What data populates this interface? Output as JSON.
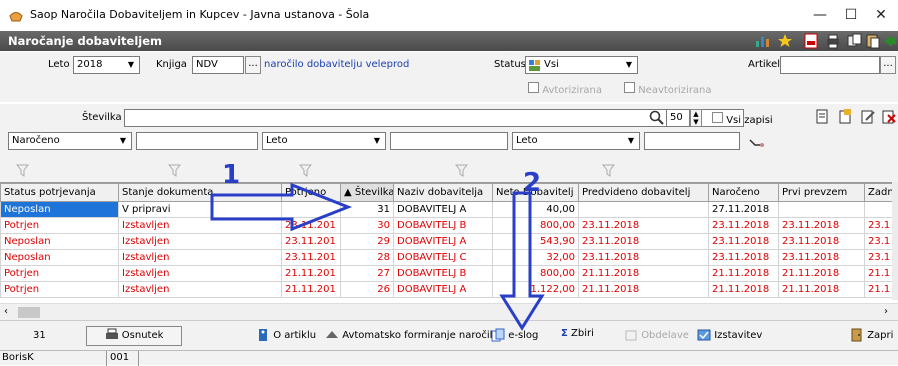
{
  "window": {
    "title": "Saop  Naročila Dobaviteljem in Kupcev - Javna ustanova - Šola",
    "minimize": "—",
    "maximize": "☐",
    "close": "✕"
  },
  "panel": {
    "title": "Naročanje dobaviteljem"
  },
  "filters": {
    "leto_label": "Leto",
    "leto_value": "2018",
    "knjiga_label": "Knjiga",
    "knjiga_value": "NDV",
    "knjiga_desc": "naročilo dobavitelju veleprod",
    "status_label": "Status",
    "status_value": "Vsi",
    "avtorizirana": "Avtorizirana",
    "neavtorizirana": "Neavtorizirana",
    "artikel_label": "Artikel",
    "ellipsis": "..."
  },
  "search": {
    "stevilka_label": "Številka",
    "count_value": "50",
    "vsi_zapisi": "Vsi zapisi",
    "narocen_value": "Naročeno",
    "leto1": "Leto",
    "leto2": "Leto"
  },
  "table": {
    "columns": [
      "Status potrjevanja",
      "Stanje dokumenta",
      "Potrjeno",
      "▲ Številka",
      "Naziv dobavitelja",
      "Neto Dobavitelj",
      "Predvideno dobavitelj",
      "Naročeno",
      "Prvi prevzem",
      "Zadn"
    ],
    "rows": [
      {
        "status": "Neposlan",
        "stanje": "V pripravi",
        "potrjeno": "",
        "st": "31",
        "naziv": "DOBAVITELJ  A",
        "neto": "40,00",
        "predv": "",
        "narocen": "27.11.2018",
        "prvi": "",
        "zadn": "",
        "red": false
      },
      {
        "status": "Potrjen",
        "stanje": "Izstavljen",
        "potrjeno": "23.11.201",
        "st": "30",
        "naziv": "DOBAVITELJ  B",
        "neto": "800,00",
        "predv": "23.11.2018",
        "narocen": "23.11.2018",
        "prvi": "23.11.2018",
        "zadn": "23.1",
        "red": true
      },
      {
        "status": "Neposlan",
        "stanje": "Izstavljen",
        "potrjeno": "23.11.201",
        "st": "29",
        "naziv": "DOBAVITELJ  A",
        "neto": "543,90",
        "predv": "23.11.2018",
        "narocen": "23.11.2018",
        "prvi": "23.11.2018",
        "zadn": "23.1",
        "red": true
      },
      {
        "status": "Neposlan",
        "stanje": "Izstavljen",
        "potrjeno": "23.11.201",
        "st": "28",
        "naziv": "DOBAVITELJ C",
        "neto": "32,00",
        "predv": "23.11.2018",
        "narocen": "23.11.2018",
        "prvi": "23.11.2018",
        "zadn": "23.1",
        "red": true
      },
      {
        "status": "Potrjen",
        "stanje": "Izstavljen",
        "potrjeno": "21.11.201",
        "st": "27",
        "naziv": "DOBAVITELJ  B",
        "neto": "800,00",
        "predv": "21.11.2018",
        "narocen": "21.11.2018",
        "prvi": "21.11.2018",
        "zadn": "21.1",
        "red": true
      },
      {
        "status": "Potrjen",
        "stanje": "Izstavljen",
        "potrjeno": "21.11.201",
        "st": "26",
        "naziv": "DOBAVITELJ  A",
        "neto": "1.122,00",
        "predv": "21.11.2018",
        "narocen": "21.11.2018",
        "prvi": "21.11.2018",
        "zadn": "21.1",
        "red": true
      }
    ]
  },
  "bottom": {
    "count": "31",
    "osnutek": "Osnutek",
    "o_artiklu": "O artiklu",
    "avtomatsko": "Avtomatsko formiranje naročil",
    "e_slog": "e-slog",
    "zbiri": "Zbiri",
    "obdelave": "Obdelave",
    "izstavitev": "Izstavitev",
    "zapri": "Zapri"
  },
  "status": {
    "user": "BorisK",
    "code": "001"
  },
  "annotations": {
    "one": "1",
    "two": "2"
  },
  "colors": {
    "header": "#555555",
    "selected": "#1e74d8",
    "red_text": "#e00000",
    "annotation": "#2a3fc8"
  }
}
